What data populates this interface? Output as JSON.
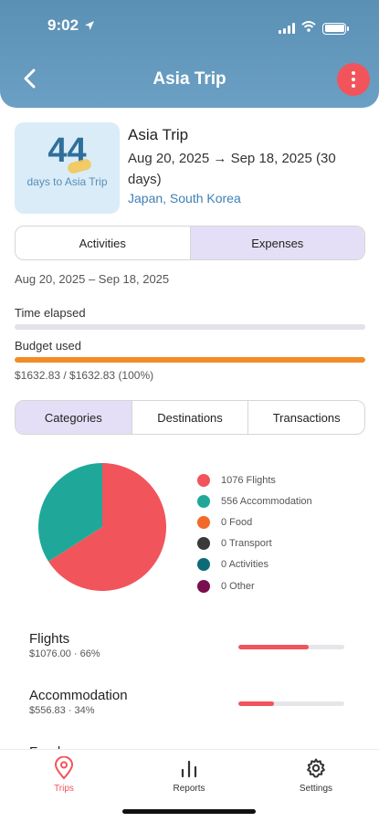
{
  "status_bar": {
    "time": "9:02"
  },
  "header": {
    "title": "Asia Trip"
  },
  "trip": {
    "days_count": "44",
    "days_label": "days to Asia Trip",
    "name": "Asia Trip",
    "dates": "Aug 20, 2025 → Sep 18, 2025 (30 days)",
    "places": "Japan, South Korea"
  },
  "view_tabs": [
    {
      "label": "Activities",
      "active": false
    },
    {
      "label": "Expenses",
      "active": true
    }
  ],
  "date_range": "Aug 20, 2025 – Sep 18, 2025",
  "metrics": {
    "time_elapsed_label": "Time elapsed",
    "time_elapsed_fraction": 0.0,
    "budget_used_label": "Budget used",
    "budget_used_fraction": 1.0,
    "budget_text": "$1632.83 / $1632.83 (100%)"
  },
  "breakdown_tabs": [
    {
      "label": "Categories",
      "active": true
    },
    {
      "label": "Destinations",
      "active": false
    },
    {
      "label": "Transactions",
      "active": false
    }
  ],
  "colors": {
    "accent": "#f2545b",
    "flights": "#f2545b",
    "accommodation": "#1fa89a",
    "food": "#f26a2a",
    "transport": "#3a3a3a",
    "activities": "#0d6b78",
    "other": "#7a0f4f"
  },
  "chart_data": {
    "type": "pie",
    "series": [
      {
        "name": "Flights",
        "value": 1076,
        "color": "#f2545b"
      },
      {
        "name": "Accommodation",
        "value": 556,
        "color": "#1fa89a"
      },
      {
        "name": "Food",
        "value": 0,
        "color": "#f26a2a"
      },
      {
        "name": "Transport",
        "value": 0,
        "color": "#3a3a3a"
      },
      {
        "name": "Activities",
        "value": 0,
        "color": "#0d6b78"
      },
      {
        "name": "Other",
        "value": 0,
        "color": "#7a0f4f"
      }
    ],
    "legend_position": "right"
  },
  "legend": [
    {
      "label": "1076 Flights",
      "color": "#f2545b"
    },
    {
      "label": "556 Accommodation",
      "color": "#1fa89a"
    },
    {
      "label": "0 Food",
      "color": "#f26a2a"
    },
    {
      "label": "0 Transport",
      "color": "#3a3a3a"
    },
    {
      "label": "0 Activities",
      "color": "#0d6b78"
    },
    {
      "label": "0 Other",
      "color": "#7a0f4f"
    }
  ],
  "categories": [
    {
      "name": "Flights",
      "detail": "$1076.00 · 66%",
      "fraction": 0.66
    },
    {
      "name": "Accommodation",
      "detail": "$556.83 · 34%",
      "fraction": 0.34
    }
  ],
  "next_category_peek": "Food",
  "tabbar": [
    {
      "label": "Trips",
      "icon": "location-pin-icon",
      "active": true
    },
    {
      "label": "Reports",
      "icon": "bar-chart-icon",
      "active": false
    },
    {
      "label": "Settings",
      "icon": "gear-icon",
      "active": false
    }
  ]
}
